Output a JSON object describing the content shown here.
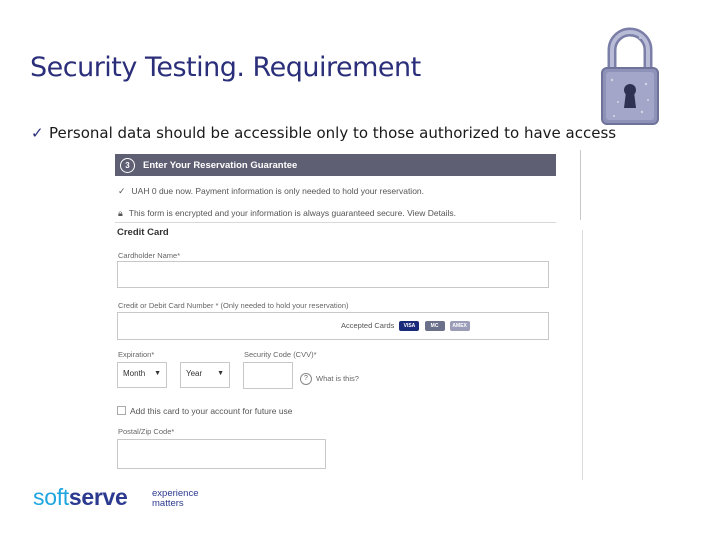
{
  "slide": {
    "title": "Security Testing. Requirement",
    "bullet_check": "✓",
    "bullet_text": "Personal data should be accessible only to those authorized to have access"
  },
  "form": {
    "step_number": "3",
    "step_title": "Enter Your Reservation Guarantee",
    "notice_1": "UAH 0 due now. Payment information is only needed to hold your reservation.",
    "notice_2": "This form is encrypted and your information is always guaranteed secure. View Details.",
    "credit_card_heading": "Credit Card",
    "cardholder_label": "Cardholder Name*",
    "cardholder_value": "",
    "card_number_label": "Credit or Debit Card Number *  (Only needed to hold your reservation)",
    "card_number_value": "",
    "accepted_cards_label": "Accepted Cards",
    "cards": [
      "VISA",
      "MC",
      "AMEX"
    ],
    "expiration_label": "Expiration*",
    "month_value": "Month",
    "year_value": "Year",
    "security_code_label": "Security Code (CVV)*",
    "help_icon": "?",
    "help_text": "What is this?",
    "save_card_label": "Add this card to your account for future use",
    "postal_label": "Postal/Zip Code*",
    "postal_value": ""
  },
  "brand": {
    "logo_soft": "soft",
    "logo_serve": "serve",
    "tagline_1": "experience",
    "tagline_2": "matters"
  },
  "colors": {
    "title": "#2b2f7a",
    "header_bar": "#5e5f73",
    "logo_light": "#1fa6e0",
    "logo_dark": "#2b3a8f"
  }
}
